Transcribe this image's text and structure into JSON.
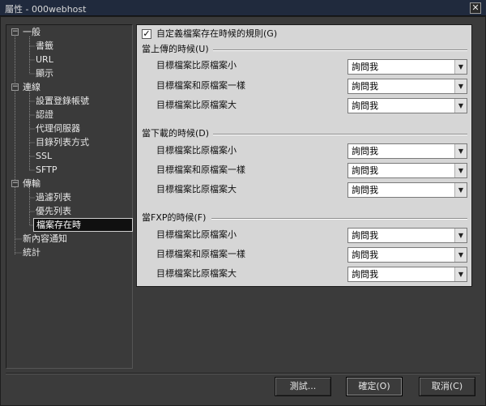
{
  "window": {
    "title": "屬性 - 000webhost",
    "close_glyph": "✕"
  },
  "tree": {
    "nodes": [
      {
        "label": "一般",
        "glyph": "⊟"
      },
      {
        "label": "書籤"
      },
      {
        "label": "URL"
      },
      {
        "label": "顯示"
      },
      {
        "label": "連線",
        "glyph": "⊟"
      },
      {
        "label": "設置登錄帳號"
      },
      {
        "label": "認證"
      },
      {
        "label": "代理伺服器"
      },
      {
        "label": "目錄列表方式"
      },
      {
        "label": "SSL"
      },
      {
        "label": "SFTP"
      },
      {
        "label": "傳輸",
        "glyph": "⊟"
      },
      {
        "label": "過濾列表"
      },
      {
        "label": "優先列表"
      },
      {
        "label": "檔案存在時"
      },
      {
        "label": "新內容通知"
      },
      {
        "label": "統計"
      }
    ]
  },
  "panel": {
    "custom_rules": {
      "label": "自定義檔案存在時候的規則(G)",
      "checked": true,
      "check_glyph": "✓"
    },
    "sections": [
      {
        "title": "當上傳的時候(U)",
        "rows": [
          {
            "label": "目標檔案比原檔案小",
            "value": "詢問我"
          },
          {
            "label": "目標檔案和原檔案一樣",
            "value": "詢問我"
          },
          {
            "label": "目標檔案比原檔案大",
            "value": "詢問我"
          }
        ]
      },
      {
        "title": "當下載的時候(D)",
        "rows": [
          {
            "label": "目標檔案比原檔案小",
            "value": "詢問我"
          },
          {
            "label": "目標檔案和原檔案一樣",
            "value": "詢問我"
          },
          {
            "label": "目標檔案比原檔案大",
            "value": "詢問我"
          }
        ]
      },
      {
        "title": "當FXP的時候(F)",
        "rows": [
          {
            "label": "目標檔案比原檔案小",
            "value": "詢問我"
          },
          {
            "label": "目標檔案和原檔案一樣",
            "value": "詢問我"
          },
          {
            "label": "目標檔案比原檔案大",
            "value": "詢問我"
          }
        ]
      }
    ],
    "dropdown_glyph": "▼"
  },
  "buttons": {
    "test": "測試...",
    "ok": "確定(O)",
    "cancel": "取消(C)"
  }
}
